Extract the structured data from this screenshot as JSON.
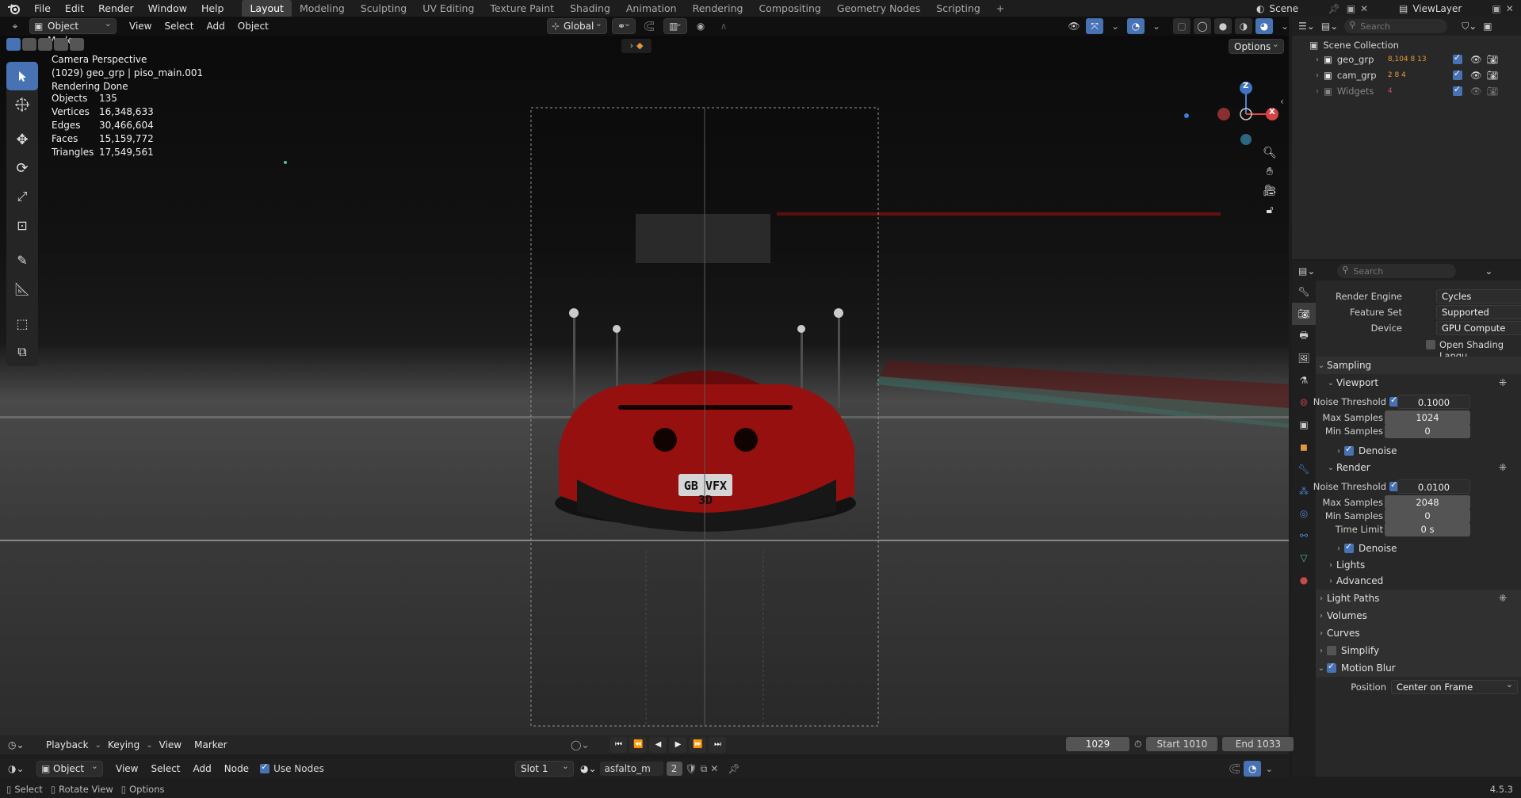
{
  "topbar": {
    "menus": [
      "File",
      "Edit",
      "Render",
      "Window",
      "Help"
    ],
    "workspaces": [
      "Layout",
      "Modeling",
      "Sculpting",
      "UV Editing",
      "Texture Paint",
      "Shading",
      "Animation",
      "Rendering",
      "Compositing",
      "Geometry Nodes",
      "Scripting"
    ],
    "active_workspace": "Layout",
    "add_tab": "+",
    "scene_label": "Scene",
    "viewlayer_label": "ViewLayer"
  },
  "viewport": {
    "mode": "Object Mode",
    "menus": [
      "View",
      "Select",
      "Add",
      "Object"
    ],
    "transform_orientation": "Global",
    "options_label": "Options",
    "overlay_lines": [
      "Camera Perspective",
      "(1029) geo_grp | piso_main.001",
      "Rendering Done"
    ],
    "stats": [
      {
        "k": "Objects",
        "v": "135"
      },
      {
        "k": "Vertices",
        "v": "16,348,633"
      },
      {
        "k": "Edges",
        "v": "30,466,604"
      },
      {
        "k": "Faces",
        "v": "15,159,772"
      },
      {
        "k": "Triangles",
        "v": "17,549,561"
      }
    ],
    "plate_text": "GB VFX 3D",
    "gizmo": {
      "z": "Z",
      "x": "X"
    }
  },
  "outliner": {
    "search_placeholder": "Search",
    "root": "Scene Collection",
    "items": [
      {
        "name": "geo_grp",
        "badges": "8,104 8 13"
      },
      {
        "name": "cam_grp",
        "badges": "2 8 4"
      },
      {
        "name": "Widgets",
        "badges": "4"
      }
    ]
  },
  "properties": {
    "search_placeholder": "Search",
    "render_engine_label": "Render Engine",
    "render_engine": "Cycles",
    "feature_set_label": "Feature Set",
    "feature_set": "Supported",
    "device_label": "Device",
    "device": "GPU Compute",
    "osl_label": "Open Shading Langu...",
    "sampling": "Sampling",
    "viewport": "Viewport",
    "vp_noise_label": "Noise Threshold",
    "vp_noise": "0.1000",
    "vp_max_label": "Max Samples",
    "vp_max": "1024",
    "vp_min_label": "Min Samples",
    "vp_min": "0",
    "denoise": "Denoise",
    "render": "Render",
    "r_noise_label": "Noise Threshold",
    "r_noise": "0.0100",
    "r_max_label": "Max Samples",
    "r_max": "2048",
    "r_min_label": "Min Samples",
    "r_min": "0",
    "time_limit_label": "Time Limit",
    "time_limit": "0 s",
    "denoise2": "Denoise",
    "lights": "Lights",
    "advanced": "Advanced",
    "light_paths": "Light Paths",
    "volumes": "Volumes",
    "curves": "Curves",
    "simplify": "Simplify",
    "motion_blur": "Motion Blur",
    "position_label": "Position",
    "position": "Center on Frame"
  },
  "timeline": {
    "menus": [
      "Playback",
      "Keying",
      "View",
      "Marker"
    ],
    "current_frame": "1029",
    "start_label": "Start",
    "start": "1010",
    "end_label": "End",
    "end": "1033"
  },
  "node_editor": {
    "type": "Object",
    "menus": [
      "View",
      "Select",
      "Add",
      "Node"
    ],
    "use_nodes": "Use Nodes",
    "slot": "Slot 1",
    "material": "asfalto_m",
    "users": "2"
  },
  "statusbar": {
    "items": [
      "Select",
      "Rotate View",
      "Options"
    ],
    "version": "4.5.3"
  },
  "colors": {
    "accent": "#4772b3",
    "car_red": "#b01414",
    "bg": "#1d1d1d"
  }
}
